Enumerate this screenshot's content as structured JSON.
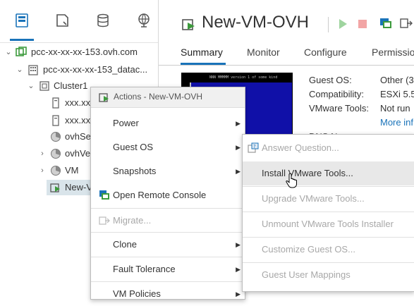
{
  "navigator": {
    "tree": [
      {
        "label": "pcc-xx-xx-xx-153.ovh.com",
        "icon": "vcenter-icon",
        "expanded": true
      },
      {
        "label": "pcc-xx-xx-xx-153_datac...",
        "icon": "datacenter-icon",
        "expanded": true
      },
      {
        "label": "Cluster1",
        "icon": "cluster-icon",
        "expanded": true
      },
      {
        "label": "xxx.xx",
        "icon": "host-icon"
      },
      {
        "label": "xxx.xx",
        "icon": "host-icon"
      },
      {
        "label": "ovhSe",
        "icon": "resource-pool-icon"
      },
      {
        "label": "ovhVe",
        "icon": "resource-pool-icon",
        "expandable": true
      },
      {
        "label": "VM",
        "icon": "resource-pool-icon",
        "expandable": true
      },
      {
        "label": "New-V",
        "icon": "vm-powered-off-icon",
        "selected": true
      }
    ]
  },
  "main": {
    "title": "New-VM-OVH",
    "tabs": [
      "Summary",
      "Monitor",
      "Configure",
      "Permissio"
    ],
    "active_tab": "Summary",
    "console_text": "NNN MMMMM version 1 of some kind",
    "summary": [
      {
        "label": "Guest OS:",
        "value": "Other (3"
      },
      {
        "label": "Compatibility:",
        "value": "ESXi 5.5"
      },
      {
        "label": "VMware Tools:",
        "value": "Not run"
      }
    ],
    "more_info": "More inf",
    "partial_lower": [
      "DNS N",
      "x"
    ]
  },
  "actions_menu": {
    "title": "Actions - New-VM-OVH",
    "items": [
      {
        "label": "Power",
        "submenu": true
      },
      {
        "label": "Guest OS",
        "submenu": true
      },
      {
        "label": "Snapshots",
        "submenu": true
      },
      {
        "label": "Open Remote Console",
        "icon": "remote-console-icon"
      },
      {
        "label": "Migrate...",
        "disabled": true,
        "icon": "migrate-icon"
      },
      {
        "label": "Clone",
        "submenu": true
      },
      {
        "label": "Fault Tolerance",
        "submenu": true
      },
      {
        "label": "VM Policies",
        "submenu": true
      }
    ]
  },
  "guest_os_submenu": {
    "items": [
      {
        "label": "Answer Question...",
        "disabled": true,
        "icon": "answer-question-icon"
      },
      {
        "label": "Install VMware Tools...",
        "hover": true
      },
      {
        "label": "Upgrade VMware Tools...",
        "disabled": true
      },
      {
        "label": "Unmount VMware Tools Installer",
        "disabled": true
      },
      {
        "label": "Customize Guest OS...",
        "disabled": true
      },
      {
        "label": "Guest User Mappings",
        "disabled": true
      }
    ]
  },
  "colors": {
    "accent": "#1a73b9",
    "vm_green": "#3c9a3c",
    "console_blue": "#1010a8",
    "menu_hover": "#e8e8e8"
  }
}
